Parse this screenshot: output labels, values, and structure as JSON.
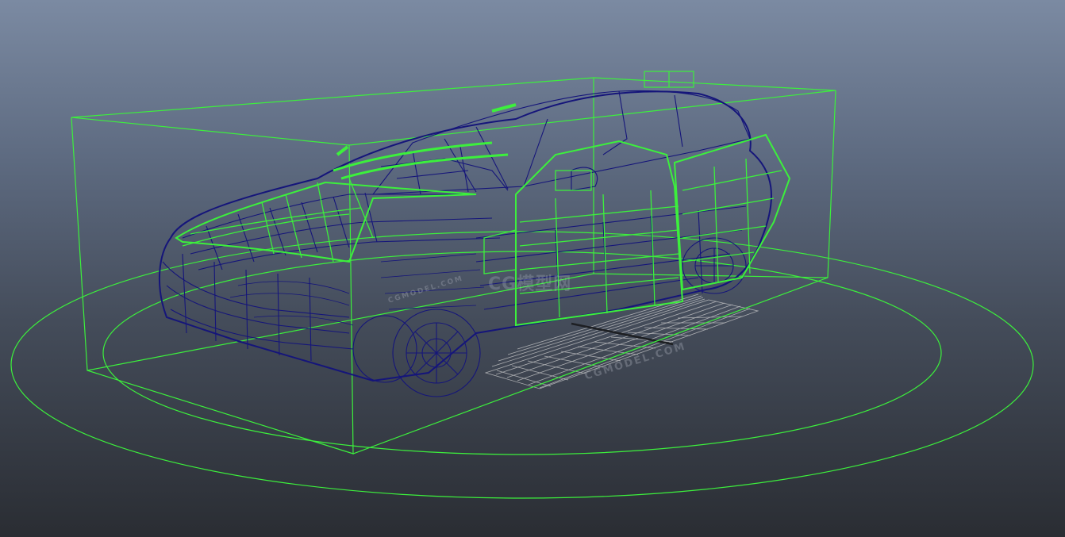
{
  "viewport": {
    "background_top": "#7b8aa2",
    "background_bottom": "#2a2d33",
    "selection_color": "#3cf03c",
    "mesh_color": "#1a1a7a",
    "grid_color": "#c8c8c8"
  },
  "watermarks": {
    "primary": "CGMODEL.COM",
    "secondary": "CGMODEL.COM"
  },
  "objects": {
    "model": "car-wireframe-icon",
    "bounding_box": "bounding-box-icon",
    "ground_rings": "ring-icon",
    "floor_grid": "grid-icon"
  }
}
